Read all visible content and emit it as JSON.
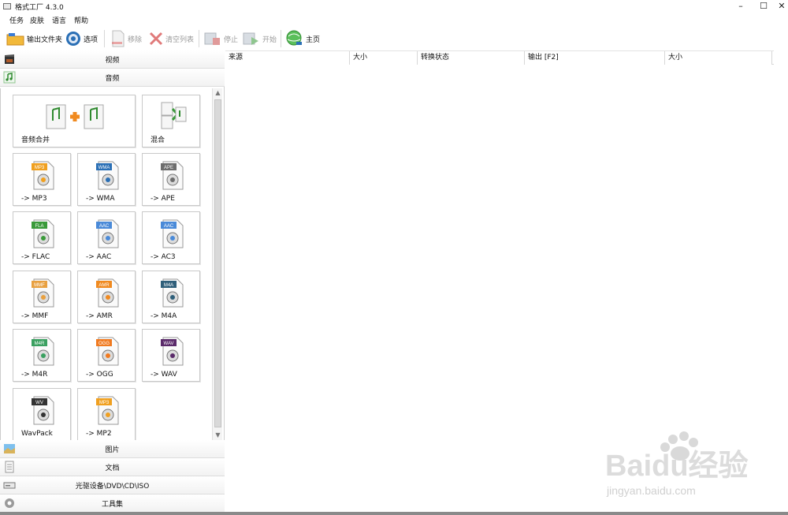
{
  "window": {
    "title": "格式工厂 4.3.0",
    "controls": [
      "–",
      "☐",
      "✕"
    ]
  },
  "menu": [
    "任务",
    "皮肤",
    "语言",
    "帮助"
  ],
  "toolbar": {
    "output_folder": "输出文件夹",
    "options": "选项",
    "remove": "移除",
    "clear_list": "清空列表",
    "stop": "停止",
    "start": "开始",
    "home": "主页"
  },
  "categories": {
    "video": "视频",
    "audio": "音频",
    "picture": "图片",
    "document": "文档",
    "optical": "光驱设备\\DVD\\CD\\ISO",
    "tools": "工具集"
  },
  "audio_tiles": [
    {
      "label": "音频合并",
      "badge": "",
      "badge_color": ""
    },
    {
      "label": "混合",
      "badge": "",
      "badge_color": ""
    },
    {
      "label": "-> MP3",
      "badge": "MP3",
      "badge_color": "#f0a020"
    },
    {
      "label": "-> WMA",
      "badge": "WMA",
      "badge_color": "#2a6fb5"
    },
    {
      "label": "-> APE",
      "badge": "APE",
      "badge_color": "#6d6d6d"
    },
    {
      "label": "-> FLAC",
      "badge": "FLA",
      "badge_color": "#3a9a3a"
    },
    {
      "label": "-> AAC",
      "badge": "AAC",
      "badge_color": "#4a8ad8"
    },
    {
      "label": "-> AC3",
      "badge": "AAC",
      "badge_color": "#4a8ad8"
    },
    {
      "label": "-> MMF",
      "badge": "MMF",
      "badge_color": "#e8a040"
    },
    {
      "label": "-> AMR",
      "badge": "AMR",
      "badge_color": "#f08a20"
    },
    {
      "label": "-> M4A",
      "badge": "M4A",
      "badge_color": "#2f5f7a"
    },
    {
      "label": "-> M4R",
      "badge": "M4R",
      "badge_color": "#3aa060"
    },
    {
      "label": "-> OGG",
      "badge": "OGG",
      "badge_color": "#f07a20"
    },
    {
      "label": "-> WAV",
      "badge": "WAV",
      "badge_color": "#5a2a6a"
    },
    {
      "label": "WavPack",
      "badge": "WV",
      "badge_color": "#333333"
    },
    {
      "label": "-> MP2",
      "badge": "MP3",
      "badge_color": "#f0a020"
    }
  ],
  "table": {
    "columns": [
      "来源",
      "大小",
      "转换状态",
      "输出 [F2]",
      "大小"
    ]
  },
  "watermark": {
    "brand": "Baidu经验",
    "url": "jingyan.baidu.com"
  },
  "colors": {
    "accent_green": "#3a9a3a",
    "note_orange": "#f0a020"
  }
}
